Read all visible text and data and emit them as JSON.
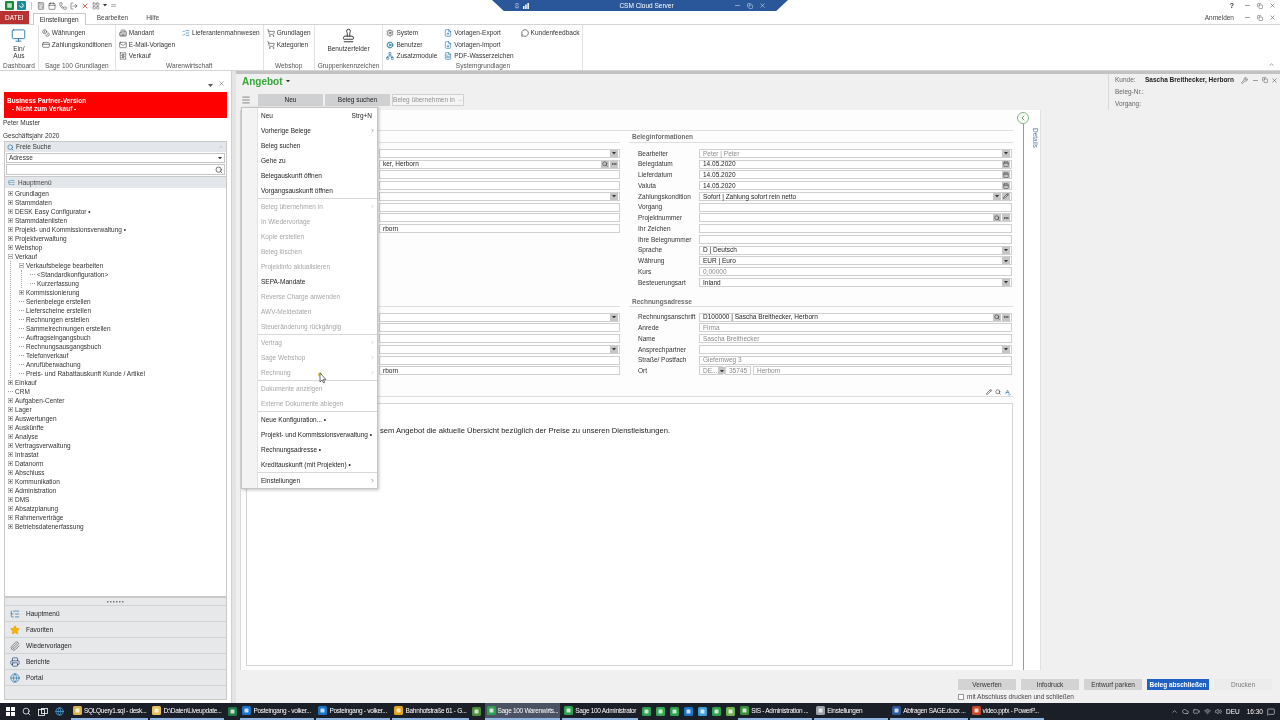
{
  "title_bar": {
    "title": "CSM Cloud Server",
    "help": "?"
  },
  "ribbon": {
    "tabs": [
      {
        "label": "DATEI",
        "kind": "file",
        "selected": false
      },
      {
        "label": "Einstellungen",
        "kind": "tab",
        "selected": true
      },
      {
        "label": "Bearbeiten",
        "kind": "tab",
        "selected": false
      },
      {
        "label": "Hilfe",
        "kind": "tab",
        "selected": false
      }
    ],
    "account": "Anmelden",
    "groups": [
      {
        "label": "Dashboard",
        "columns": [
          [
            {
              "label": "Ein/ Aus",
              "kind": "large"
            }
          ]
        ]
      },
      {
        "label": "Sage 100 Grundlagen",
        "columns": [
          [
            {
              "label": "Währungen",
              "kind": "small"
            },
            {
              "label": "Zahlungskonditionen",
              "kind": "small"
            }
          ]
        ]
      },
      {
        "label": "Warenwirtschaft",
        "columns": [
          [
            {
              "label": "Mandant",
              "kind": "small"
            },
            {
              "label": "E-Mail-Vorlagen",
              "kind": "small"
            },
            {
              "label": "Verkauf",
              "kind": "small"
            }
          ],
          [
            {
              "label": "Lieferantenmahnwesen",
              "kind": "small"
            }
          ]
        ]
      },
      {
        "label": "Webshop",
        "columns": [
          [
            {
              "label": "Grundlagen",
              "kind": "small"
            },
            {
              "label": "Kategorien",
              "kind": "small"
            }
          ]
        ]
      },
      {
        "label": "Gruppenkennzeichen",
        "columns": [
          [
            {
              "label": "Benutzerfelder",
              "kind": "large"
            }
          ]
        ]
      },
      {
        "label": "Systemgrundlagen",
        "columns": [
          [
            {
              "label": "System",
              "kind": "small"
            },
            {
              "label": "Benutzer",
              "kind": "small"
            },
            {
              "label": "Zusatzmodule",
              "kind": "small"
            }
          ],
          [
            {
              "label": "Vorlagen-Export",
              "kind": "small"
            },
            {
              "label": "Vorlagen-Import",
              "kind": "small"
            },
            {
              "label": "PDF-Wasserzeichen",
              "kind": "small"
            }
          ],
          [
            {
              "label": "Kundenfeedback",
              "kind": "small"
            }
          ]
        ]
      }
    ]
  },
  "left_panel": {
    "banner": {
      "title": "Business Partner-Version",
      "note": "- Nicht zum Verkauf -"
    },
    "user": "Peter Muster",
    "fiscal_year": "Geschäftsjahr 2020",
    "search": {
      "title": "Freie Suche",
      "scope": "Adresse"
    },
    "menu_title": "Hauptmenü",
    "tree": [
      {
        "label": "Grundlagen",
        "expanded": false
      },
      {
        "label": "Stammdaten",
        "expanded": false
      },
      {
        "label": "DESK Easy Configurator •",
        "expanded": false
      },
      {
        "label": "Stammdatenlisten",
        "expanded": false
      },
      {
        "label": "Projekt- und Kommissionsverwaltung •",
        "expanded": false
      },
      {
        "label": "Projektverwaltung",
        "expanded": false
      },
      {
        "label": "Webshop",
        "expanded": false
      },
      {
        "label": "Verkauf",
        "expanded": true,
        "children": [
          {
            "label": "Verkaufsbelege bearbeiten",
            "expanded": true,
            "children": [
              {
                "label": "<Standardkonfiguration>"
              },
              {
                "label": "Kurzerfassung"
              }
            ]
          },
          {
            "label": "Kommissionierung",
            "expanded": false
          },
          {
            "label": "Serienbelege erstellen"
          },
          {
            "label": "Lieferscheine erstellen"
          },
          {
            "label": "Rechnungen erstellen"
          },
          {
            "label": "Sammelrechnungen erstellen"
          },
          {
            "label": "Auftragseingangsbuch"
          },
          {
            "label": "Rechnungsausgangsbuch"
          },
          {
            "label": "Telefonverkauf"
          },
          {
            "label": "Anrufüberwachung"
          },
          {
            "label": "Preis- und Rabattauskunft Kunde / Artikel"
          }
        ]
      },
      {
        "label": "Einkauf",
        "expanded": false
      },
      {
        "label": "CRM"
      },
      {
        "label": "Aufgaben-Center",
        "expanded": false
      },
      {
        "label": "Lager",
        "expanded": false
      },
      {
        "label": "Auswertungen",
        "expanded": false
      },
      {
        "label": "Auskünfte",
        "expanded": false
      },
      {
        "label": "Analyse",
        "expanded": false
      },
      {
        "label": "Vertragsverwaltung",
        "expanded": false
      },
      {
        "label": "Intrastat",
        "expanded": false
      },
      {
        "label": "Datanorm",
        "expanded": false
      },
      {
        "label": "Abschluss",
        "expanded": false
      },
      {
        "label": "Kommunikation",
        "expanded": false
      },
      {
        "label": "Administration",
        "expanded": false
      },
      {
        "label": "DMS",
        "expanded": false
      },
      {
        "label": "Absatzplanung",
        "expanded": false
      },
      {
        "label": "Rahmenverträge",
        "expanded": false
      },
      {
        "label": "Betriebsdatenerfassung",
        "expanded": false
      }
    ],
    "nav": [
      {
        "label": "Hauptmenü"
      },
      {
        "label": "Favoriten"
      },
      {
        "label": "Wiedervorlagen"
      },
      {
        "label": "Berichte"
      },
      {
        "label": "Portal"
      }
    ]
  },
  "document": {
    "title": "Angebot",
    "toolbar": [
      {
        "label": "Neu",
        "kind": "button",
        "disabled": false
      },
      {
        "label": "Beleg suchen",
        "kind": "button",
        "disabled": false
      },
      {
        "label": "Beleg übernehmen in",
        "kind": "dropdown",
        "disabled": true
      }
    ],
    "context_menu": {
      "sections": [
        [
          {
            "label": "Neu",
            "shortcut": "Strg+N",
            "submenu": false,
            "disabled": false
          },
          {
            "label": "Vorherige Belege",
            "submenu": true,
            "disabled": false
          },
          {
            "label": "Beleg suchen",
            "submenu": false,
            "disabled": false
          },
          {
            "label": "Gehe zu",
            "submenu": false,
            "disabled": false
          },
          {
            "label": "Belegauskunft öffnen",
            "submenu": false,
            "disabled": false
          },
          {
            "label": "Vorgangsauskunft öffnen",
            "submenu": false,
            "disabled": false
          }
        ],
        [
          {
            "label": "Beleg übernehmen in",
            "submenu": true,
            "disabled": true
          },
          {
            "label": "In Wiedervorlage",
            "submenu": false,
            "disabled": true
          },
          {
            "label": "Kopie erstellen",
            "submenu": false,
            "disabled": true
          },
          {
            "label": "Beleg löschen",
            "submenu": false,
            "disabled": true
          },
          {
            "label": "Projektinfo aktualisieren",
            "submenu": false,
            "disabled": true
          },
          {
            "label": "SEPA-Mandate",
            "submenu": false,
            "disabled": false
          },
          {
            "label": "Reverse Charge anwenden",
            "submenu": false,
            "disabled": true
          },
          {
            "label": "AWV-Meldedaten",
            "submenu": false,
            "disabled": true
          },
          {
            "label": "Steueränderung rückgängig",
            "submenu": false,
            "disabled": true
          }
        ],
        [
          {
            "label": "Vertrag",
            "submenu": true,
            "disabled": true
          },
          {
            "label": "Sage Webshop",
            "submenu": true,
            "disabled": true
          },
          {
            "label": "Rechnung",
            "submenu": true,
            "disabled": true
          }
        ],
        [
          {
            "label": "Dokumente anzeigen",
            "submenu": false,
            "disabled": true
          },
          {
            "label": "Externe Dokumente ablegen",
            "submenu": false,
            "disabled": true
          }
        ],
        [
          {
            "label": "Neue Konfiguration... •",
            "submenu": false,
            "disabled": false
          },
          {
            "label": "Projekt- und Kommissionsverwaltung •",
            "submenu": false,
            "disabled": false
          },
          {
            "label": "Rechnungsadresse •",
            "submenu": false,
            "disabled": false
          },
          {
            "label": "Kreditauskunft (mit Projekten) •",
            "submenu": false,
            "disabled": false
          }
        ],
        [
          {
            "label": "Einstellungen",
            "submenu": true,
            "disabled": false
          }
        ]
      ]
    },
    "customer_info": [
      {
        "label": "Kunde:",
        "value": "Sascha Breithecker, Herborn"
      },
      {
        "label": "Beleg-Nr.:"
      },
      {
        "label": "Vorgang:"
      }
    ],
    "form": {
      "sections": [
        {
          "left_fields": [
            {
              "kind": "select"
            },
            {
              "kind": "lookup",
              "value": "ker, Herborn"
            },
            {
              "kind": "text"
            },
            {
              "kind": "text"
            },
            {
              "kind": "select"
            },
            {
              "kind": "text"
            },
            {
              "kind": "text"
            },
            {
              "kind": "text",
              "value": "rborn"
            }
          ],
          "right_title": "Beleginformationen",
          "right_fields": [
            {
              "label": "Bearbeiter",
              "kind": "select",
              "value": "Peter | Peter",
              "readonly": true
            },
            {
              "label": "Belegdatum",
              "kind": "date",
              "value": "14.05.2020",
              "readonly": false
            },
            {
              "label": "Lieferdatum",
              "kind": "date",
              "value": "14.05.2020",
              "readonly": false
            },
            {
              "label": "Valuta",
              "kind": "date",
              "value": "14.05.2020",
              "readonly": false
            },
            {
              "label": "Zahlungskondition",
              "kind": "terms",
              "value": "Sofort | Zahlung sofort rein netto",
              "readonly": false
            },
            {
              "label": "Vorgang",
              "kind": "text"
            },
            {
              "label": "Projektnummer",
              "kind": "lookup"
            },
            {
              "label": "Ihr Zeichen",
              "kind": "text"
            },
            {
              "label": "Ihre Belegnummer",
              "kind": "text"
            },
            {
              "label": "Sprache",
              "kind": "select",
              "value": "D | Deutsch",
              "readonly": false
            },
            {
              "label": "Währung",
              "kind": "select",
              "value": "EUR | Euro",
              "readonly": false
            },
            {
              "label": "Kurs",
              "kind": "text",
              "value": "0,00000",
              "readonly": true
            },
            {
              "label": "Besteuerungsart",
              "kind": "select",
              "value": "Inland",
              "readonly": false
            }
          ]
        },
        {
          "left_fields": [
            {
              "kind": "select"
            },
            {
              "kind": "text"
            },
            {
              "kind": "text"
            },
            {
              "kind": "select"
            },
            {
              "kind": "text"
            },
            {
              "kind": "text",
              "value": "rborn"
            }
          ],
          "right_title": "Rechnungsadresse",
          "right_fields": [
            {
              "label": "Rechnungsanschrift",
              "kind": "lookup",
              "value": "D100000 | Sascha Breithecker, Herborn",
              "readonly": false
            },
            {
              "label": "Anrede",
              "kind": "text",
              "value": "Firma",
              "readonly": true
            },
            {
              "label": "Name",
              "kind": "text",
              "value": "Sascha Breithecker",
              "readonly": true
            },
            {
              "label": "Ansprechpartner",
              "kind": "select"
            },
            {
              "label": "Straße/ Postfach",
              "kind": "text",
              "value": "Giefernweg 3",
              "readonly": true
            },
            {
              "label": "Ort",
              "kind": "location",
              "parts": [
                "DE...",
                "35745",
                "Herborn"
              ],
              "readonly": true
            }
          ]
        }
      ],
      "notes": "sem Angebot die aktuelle Übersicht bezüglich der Preise zu unseren Dienstleistungen."
    },
    "details": "Details",
    "actions": [
      {
        "label": "Verwerfen",
        "kind": "secondary",
        "disabled": false
      },
      {
        "label": "Infodruck",
        "kind": "secondary",
        "disabled": false
      },
      {
        "label": "Entwurf parken",
        "kind": "secondary",
        "disabled": false
      },
      {
        "label": "Beleg abschließen",
        "kind": "primary",
        "disabled": false
      },
      {
        "label": "Drucken",
        "kind": "secondary",
        "disabled": true
      }
    ],
    "close_option": {
      "label": "mit Abschluss drucken und schließen",
      "checked": false
    }
  },
  "taskbar": {
    "items": [
      {
        "kind": "window",
        "label": "SQLQuery1.sql - desk...",
        "selected": false
      },
      {
        "kind": "window",
        "label": "D:\\Daten\\Liveupdate...",
        "selected": false
      },
      {
        "kind": "pinned"
      },
      {
        "kind": "window",
        "label": "Posteingang - volker...",
        "selected": false
      },
      {
        "kind": "window",
        "label": "Posteingang - volker...",
        "selected": false
      },
      {
        "kind": "window",
        "label": "Bahnhofstraße 61 - G...",
        "selected": false
      },
      {
        "kind": "pinned"
      },
      {
        "kind": "window",
        "label": "Sage 100 Warenwirts...",
        "selected": true
      },
      {
        "kind": "window",
        "label": "Sage 100 Administrator",
        "selected": false
      },
      {
        "kind": "pinned"
      },
      {
        "kind": "pinned"
      },
      {
        "kind": "pinned"
      },
      {
        "kind": "pinned"
      },
      {
        "kind": "pinned"
      },
      {
        "kind": "pinned"
      },
      {
        "kind": "pinned"
      },
      {
        "kind": "window",
        "label": "SIS - Administration ...",
        "selected": false
      },
      {
        "kind": "window",
        "label": "Einstellungen",
        "selected": false
      },
      {
        "kind": "window",
        "label": "Abfragen SAGE.docx ...",
        "selected": false
      },
      {
        "kind": "window",
        "label": "video.pptx - PowerP...",
        "selected": false
      }
    ],
    "language": "DEU",
    "time": "16:30"
  }
}
